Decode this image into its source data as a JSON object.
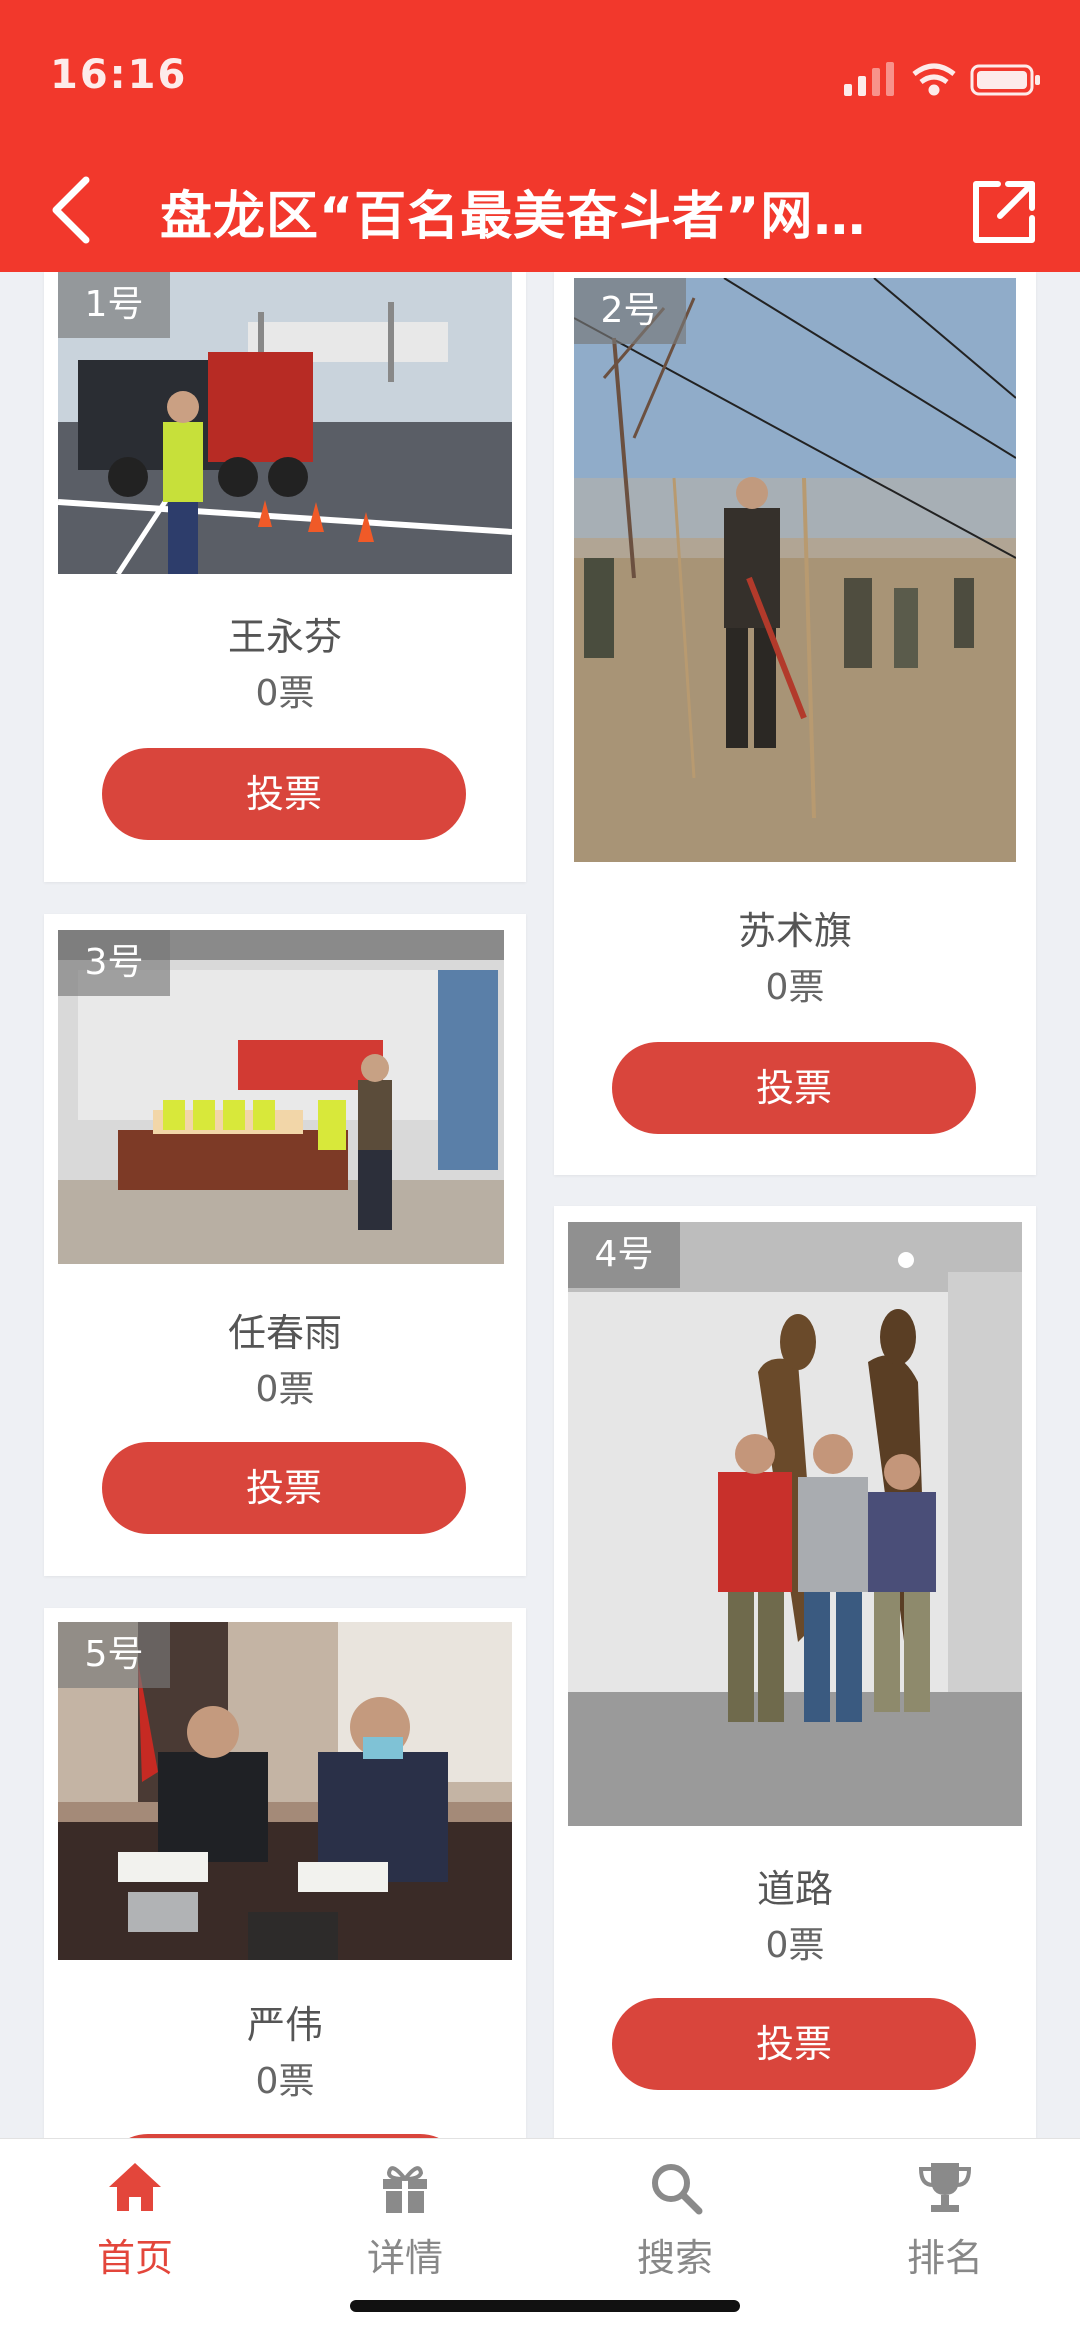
{
  "status_bar": {
    "time": "16:16"
  },
  "header": {
    "title": "盘龙区“百名最美奋斗者”网…",
    "bg_color": "#f2382c"
  },
  "candidates": [
    {
      "number": "1号",
      "name": "王永芬",
      "votes": "0票",
      "vote_label": "投票"
    },
    {
      "number": "2号",
      "name": "苏术旗",
      "votes": "0票",
      "vote_label": "投票"
    },
    {
      "number": "3号",
      "name": "任春雨",
      "votes": "0票",
      "vote_label": "投票"
    },
    {
      "number": "4号",
      "name": "道路",
      "votes": "0票",
      "vote_label": "投票"
    },
    {
      "number": "5号",
      "name": "严伟",
      "votes": "0票",
      "vote_label": "投票"
    }
  ],
  "bottom_nav": [
    {
      "label": "首页",
      "icon": "home-icon",
      "active": true
    },
    {
      "label": "详情",
      "icon": "gift-icon",
      "active": false
    },
    {
      "label": "搜索",
      "icon": "search-icon",
      "active": false
    },
    {
      "label": "排名",
      "icon": "trophy-icon",
      "active": false
    }
  ],
  "colors": {
    "accent": "#d9453c",
    "active_nav": "#e3463b",
    "inactive_nav": "#888888"
  }
}
